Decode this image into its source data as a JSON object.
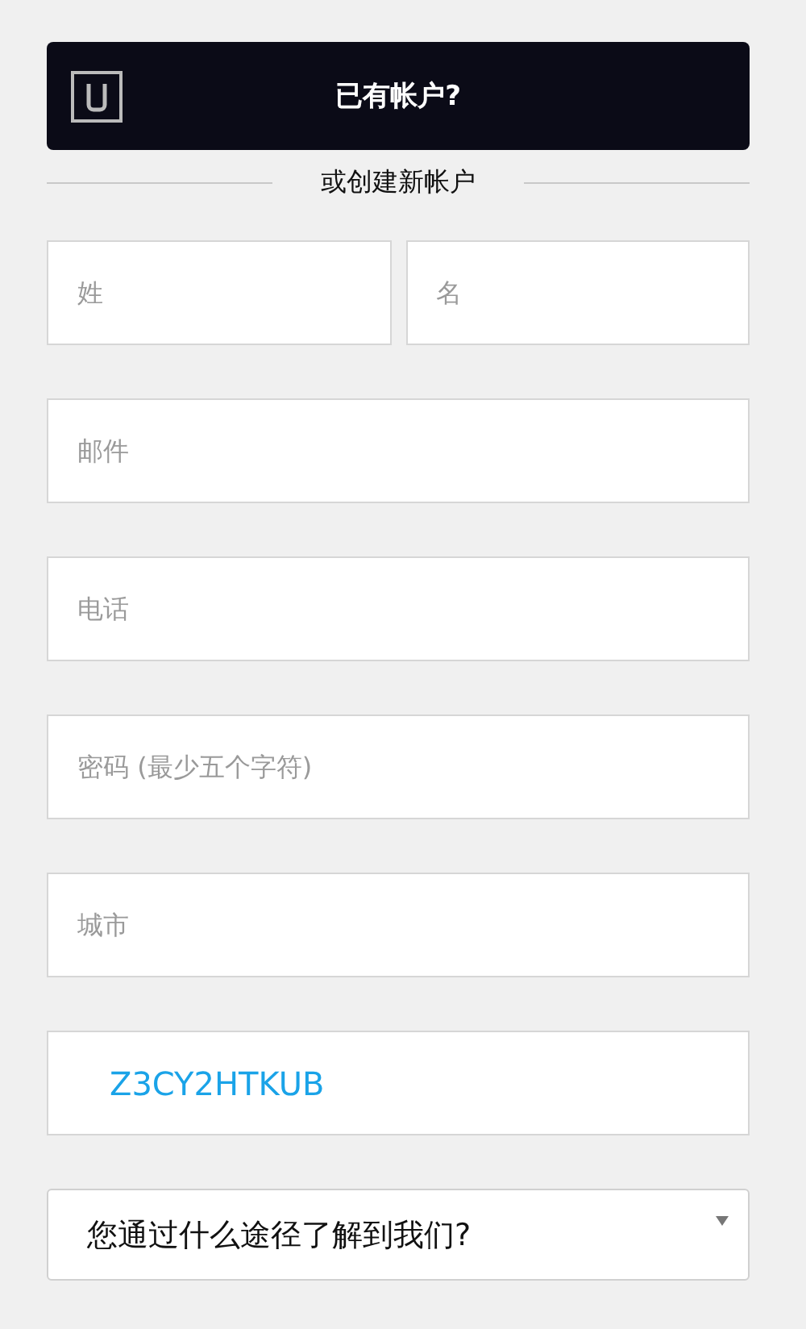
{
  "login_button": {
    "label": "已有帐户?"
  },
  "divider": {
    "label": "或创建新帐户"
  },
  "name_fields": [
    {
      "placeholder": "姓"
    },
    {
      "placeholder": "名"
    }
  ],
  "fields": [
    {
      "kind": "input",
      "placeholder": "邮件"
    },
    {
      "kind": "input",
      "placeholder": "电话"
    },
    {
      "kind": "input",
      "placeholder": "密码 (最少五个字符)"
    },
    {
      "kind": "input",
      "placeholder": "城市"
    },
    {
      "kind": "code",
      "value": "Z3CY2HTKUB"
    },
    {
      "kind": "select",
      "value": "您通过什么途径了解到我们?"
    }
  ]
}
